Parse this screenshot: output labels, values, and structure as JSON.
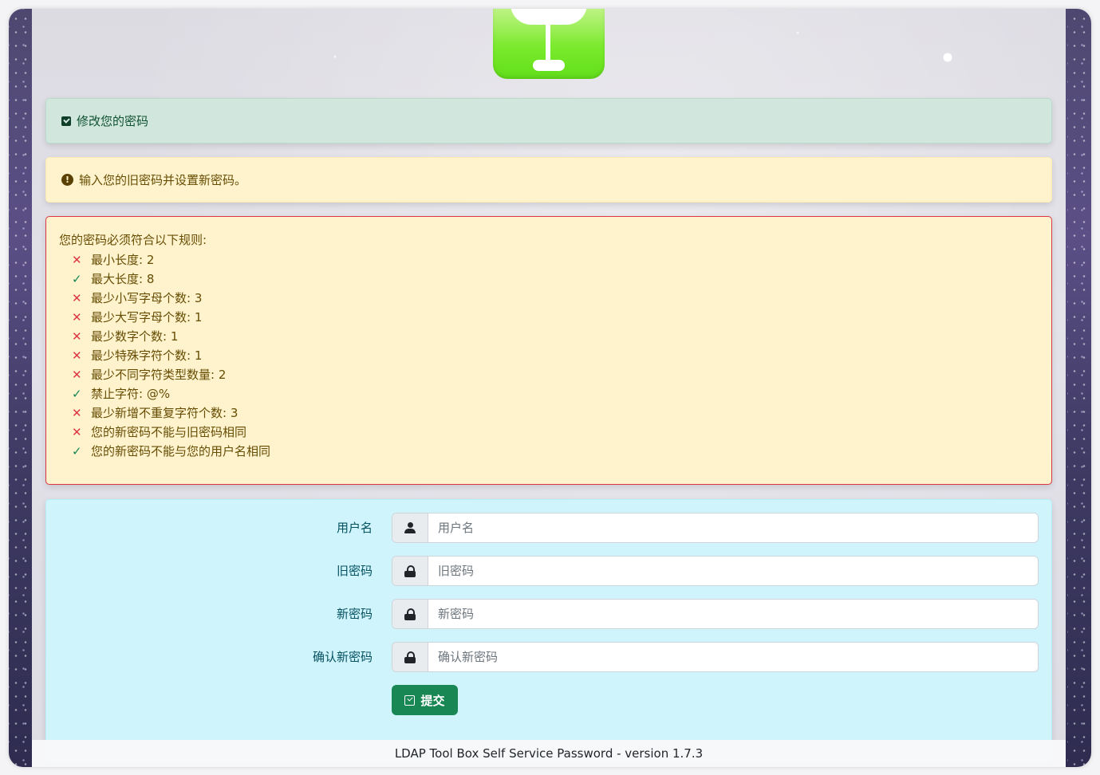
{
  "success_alert": {
    "icon": "check-square-icon",
    "text": "修改您的密码"
  },
  "warning_alert": {
    "icon": "exclamation-circle-icon",
    "text": "输入您的旧密码并设置新密码。"
  },
  "rules": {
    "title": "您的密码必须符合以下规则:",
    "items": [
      {
        "status": "fail",
        "mark": "✕",
        "text": "最小长度: 2"
      },
      {
        "status": "ok",
        "mark": "✓",
        "text": "最大长度: 8"
      },
      {
        "status": "fail",
        "mark": "✕",
        "text": "最少小写字母个数: 3"
      },
      {
        "status": "fail",
        "mark": "✕",
        "text": "最少大写字母个数: 1"
      },
      {
        "status": "fail",
        "mark": "✕",
        "text": "最少数字个数: 1"
      },
      {
        "status": "fail",
        "mark": "✕",
        "text": "最少特殊字符个数: 1"
      },
      {
        "status": "fail",
        "mark": "✕",
        "text": "最少不同字符类型数量: 2"
      },
      {
        "status": "ok",
        "mark": "✓",
        "text": "禁止字符: @%"
      },
      {
        "status": "fail",
        "mark": "✕",
        "text": "最少新增不重复字符个数: 3"
      },
      {
        "status": "fail",
        "mark": "✕",
        "text": "您的新密码不能与旧密码相同"
      },
      {
        "status": "ok",
        "mark": "✓",
        "text": "您的新密码不能与您的用户名相同"
      }
    ]
  },
  "form": {
    "username": {
      "label": "用户名",
      "placeholder": "用户名",
      "value": "",
      "icon": "user-icon"
    },
    "old_password": {
      "label": "旧密码",
      "placeholder": "旧密码",
      "value": "",
      "icon": "lock-icon"
    },
    "new_password": {
      "label": "新密码",
      "placeholder": "新密码",
      "value": "",
      "icon": "lock-icon"
    },
    "confirm_password": {
      "label": "确认新密码",
      "placeholder": "确认新密码",
      "value": "",
      "icon": "lock-icon"
    },
    "submit_label": "提交"
  },
  "footer": {
    "text": "LDAP Tool Box Self Service Password - version 1.7.3"
  },
  "colors": {
    "success_bg": "#d1e7dd",
    "warning_bg": "#fff3cd",
    "info_bg": "#cff4fc",
    "fail": "#dc3545",
    "ok": "#198754",
    "submit": "#198754"
  }
}
